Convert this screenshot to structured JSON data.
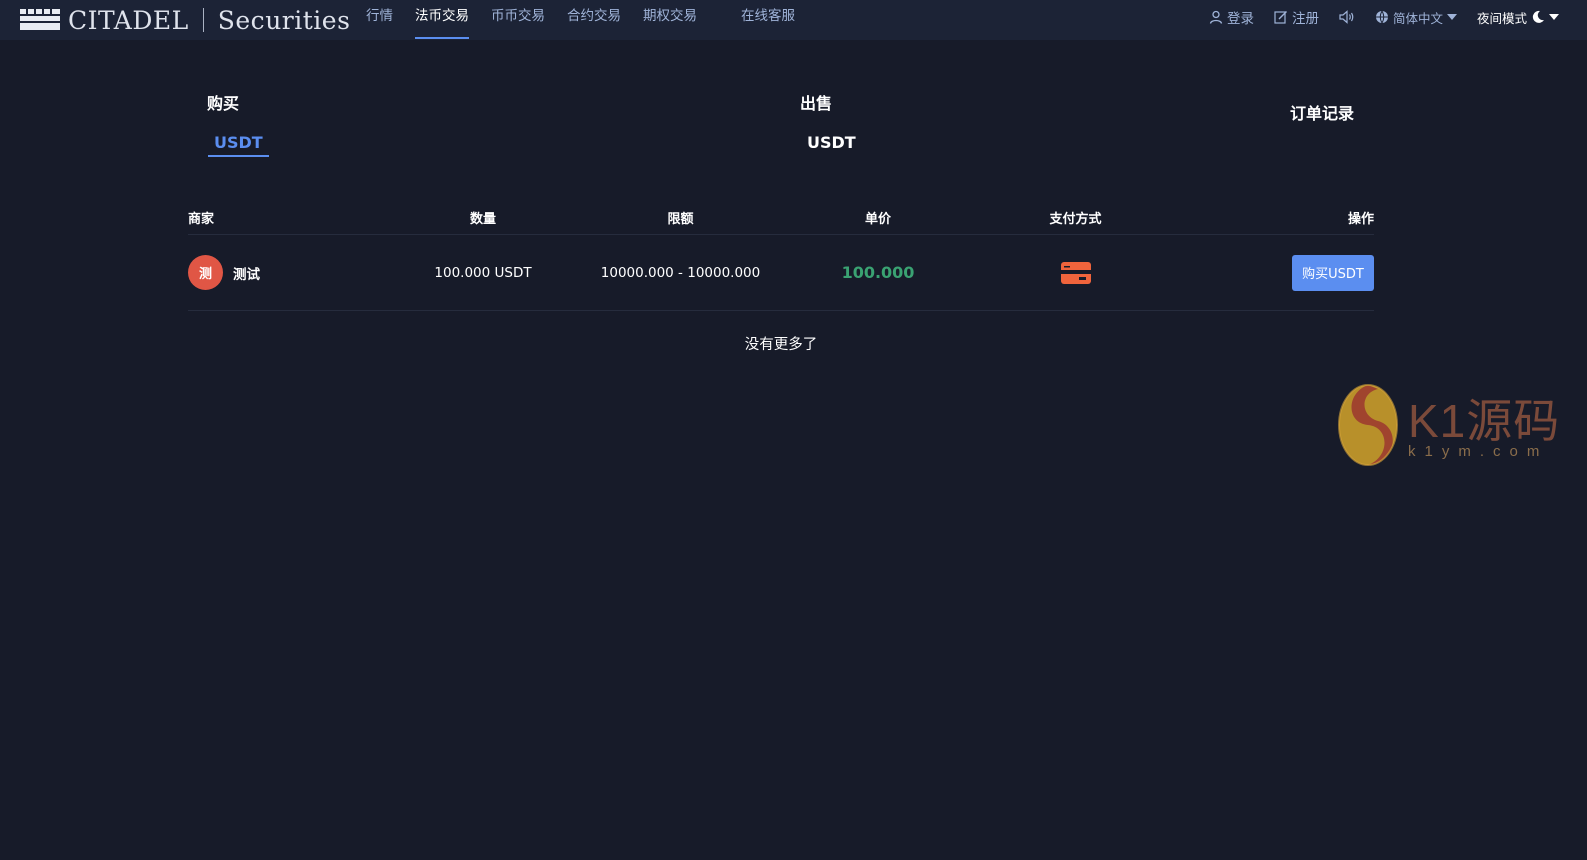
{
  "header": {
    "logo_main": "CITADEL",
    "logo_sub": "Securities",
    "nav": [
      {
        "label": "行情"
      },
      {
        "label": "法币交易"
      },
      {
        "label": "币币交易"
      },
      {
        "label": "合约交易"
      },
      {
        "label": "期权交易"
      },
      {
        "label": "在线客服"
      }
    ],
    "active_nav": "法币交易",
    "login": "登录",
    "register": "注册",
    "language": "简体中文",
    "night_mode": "夜间模式"
  },
  "tabs": {
    "buy_title": "购买",
    "buy_coin": "USDT",
    "sell_title": "出售",
    "sell_coin": "USDT",
    "orders": "订单记录"
  },
  "table": {
    "headers": {
      "merchant": "商家",
      "quantity": "数量",
      "limit": "限额",
      "price": "单价",
      "payment": "支付方式",
      "action": "操作"
    },
    "rows": [
      {
        "avatar_char": "测",
        "merchant": "测试",
        "quantity": "100.000 USDT",
        "limit": "10000.000 - 10000.000",
        "price": "100.000",
        "payment_icon": "bank-card-icon",
        "action_label": "购买USDT"
      }
    ]
  },
  "footer_note": "没有更多了",
  "watermark": {
    "brand": "K1源码",
    "url": "k1ym.com"
  },
  "colors": {
    "background": "#171b29",
    "topbar": "#1c2336",
    "accent": "#5b8ef0",
    "price_green": "#3aa272",
    "avatar_red": "#e05645",
    "card_orange": "#f0643c"
  }
}
